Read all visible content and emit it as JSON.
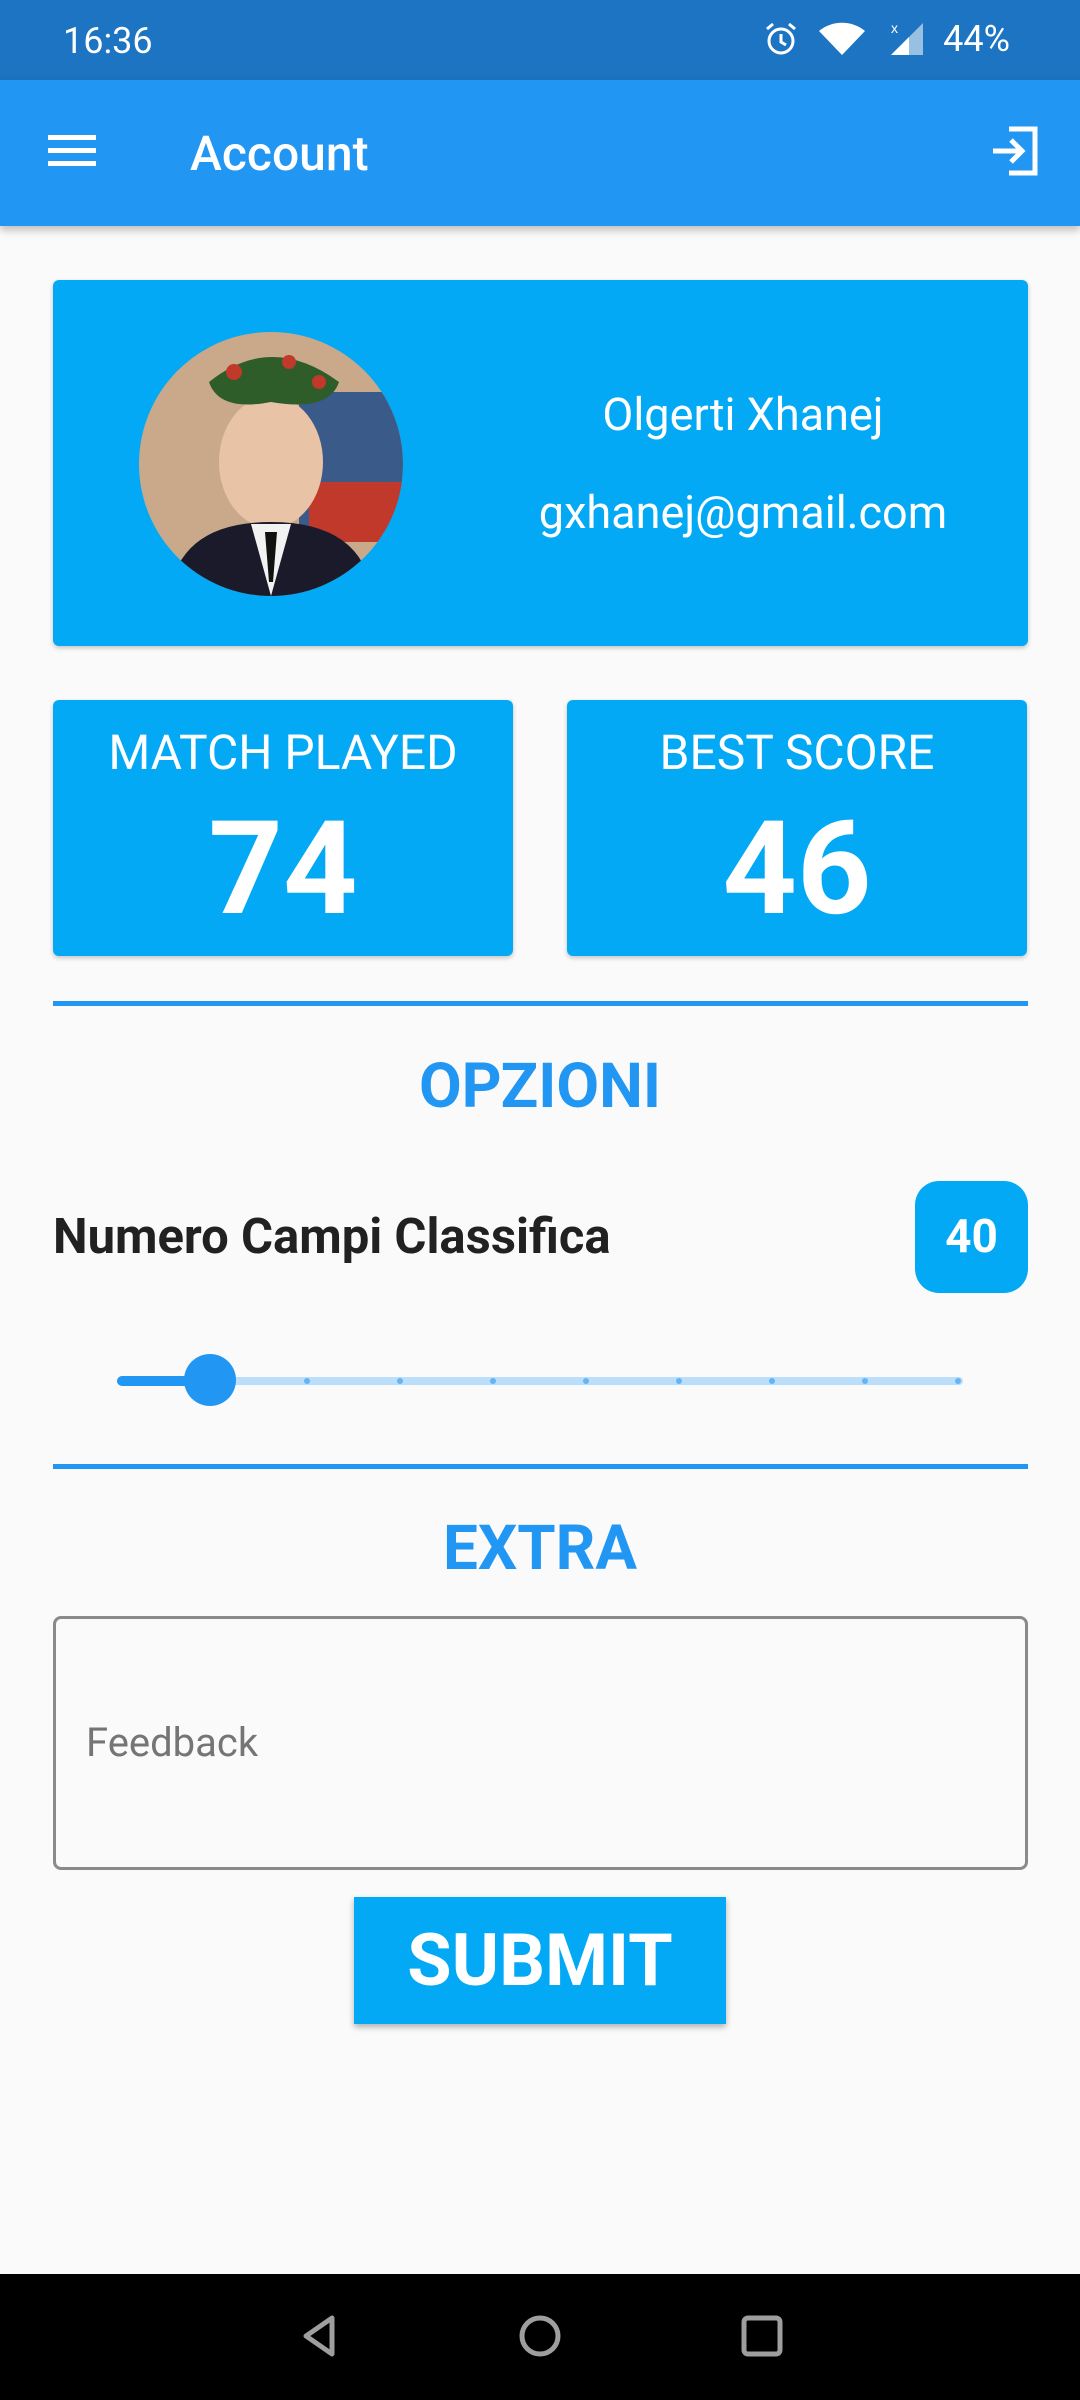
{
  "status_bar": {
    "time": "16:36",
    "battery": "44%",
    "icons": [
      "alarm-icon",
      "wifi-icon",
      "signal-icon",
      "battery-icon"
    ]
  },
  "app_bar": {
    "title": "Account",
    "menu_icon": "menu-icon",
    "logout_icon": "logout-icon"
  },
  "profile": {
    "name": "Olgerti Xhanej",
    "email": "gxhanej@gmail.com"
  },
  "stats": {
    "matches_label": "MATCH PLAYED",
    "matches_value": "74",
    "best_label": "BEST SCORE",
    "best_value": "46"
  },
  "options": {
    "title": "OPZIONI",
    "setting_label": "Numero Campi Classifica",
    "setting_value": "40",
    "slider_fraction": 0.11
  },
  "extra": {
    "title": "EXTRA",
    "feedback_placeholder": "Feedback",
    "submit_label": "SUBMIT"
  },
  "colors": {
    "app_bar": "#2196f3",
    "status_bar": "#1c74c2",
    "card": "#03a9f4",
    "accent": "#2196f3"
  }
}
